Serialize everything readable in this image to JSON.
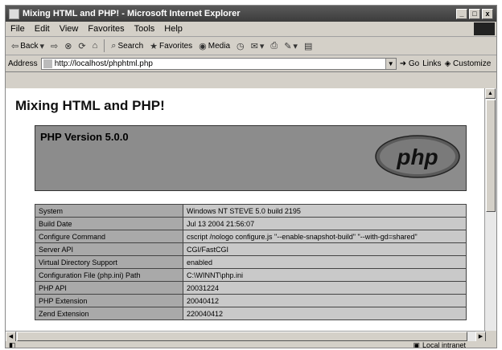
{
  "window": {
    "title": "Mixing HTML and PHP! - Microsoft Internet Explorer",
    "buttons": {
      "minimize": "_",
      "maximize": "□",
      "close": "x"
    }
  },
  "menu": [
    "File",
    "Edit",
    "View",
    "Favorites",
    "Tools",
    "Help"
  ],
  "toolbar": {
    "back": "Back",
    "search": "Search",
    "favorites": "Favorites",
    "media": "Media"
  },
  "address": {
    "label": "Address",
    "url": "http://localhost/phphtml.php",
    "go": "Go",
    "links": "Links",
    "customize": "Customize"
  },
  "page": {
    "heading": "Mixing HTML and PHP!",
    "php_version": "PHP Version 5.0.0",
    "logo_text": "php",
    "rows": [
      {
        "key": "System",
        "value": "Windows NT STEVE 5.0 build 2195"
      },
      {
        "key": "Build Date",
        "value": "Jul 13 2004 21:56:07"
      },
      {
        "key": "Configure Command",
        "value": "cscript /nologo configure.js \"--enable-snapshot-build\" \"--with-gd=shared\""
      },
      {
        "key": "Server API",
        "value": "CGI/FastCGI"
      },
      {
        "key": "Virtual Directory Support",
        "value": "enabled"
      },
      {
        "key": "Configuration File (php.ini) Path",
        "value": "C:\\WINNT\\php.ini"
      },
      {
        "key": "PHP API",
        "value": "20031224"
      },
      {
        "key": "PHP Extension",
        "value": "20040412"
      },
      {
        "key": "Zend Extension",
        "value": "220040412"
      }
    ]
  },
  "status": {
    "zone": "Local intranet"
  },
  "colors": {
    "title_bar": "#4a4a4a",
    "php_header_bg": "#8c8c8c",
    "table_key_bg": "#a9a9a9",
    "table_value_bg": "#c9c9c9"
  }
}
